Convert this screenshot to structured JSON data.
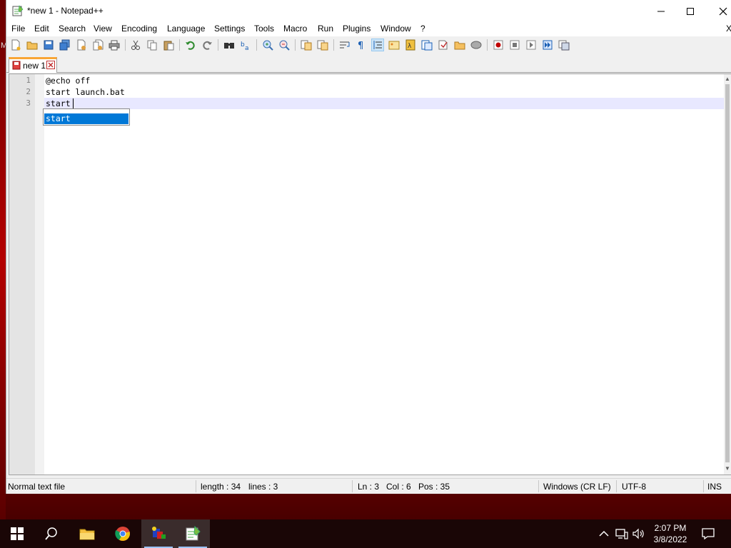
{
  "window": {
    "title": "*new 1 - Notepad++"
  },
  "desktop": {
    "edge_label": "M"
  },
  "menu": {
    "items": [
      "File",
      "Edit",
      "Search",
      "View",
      "Encoding",
      "Language",
      "Settings",
      "Tools",
      "Macro",
      "Run",
      "Plugins",
      "Window",
      "?"
    ],
    "close_label": "X"
  },
  "toolbar": {
    "icons": [
      "new-file-icon",
      "open-file-icon",
      "save-icon",
      "save-all-icon",
      "close-icon",
      "close-all-icon",
      "print-icon",
      "cut-icon",
      "copy-icon",
      "paste-icon",
      "undo-icon",
      "redo-icon",
      "find-icon",
      "replace-icon",
      "zoom-in-icon",
      "zoom-out-icon",
      "sync-v-icon",
      "sync-h-icon",
      "word-wrap-icon",
      "show-all-chars-icon",
      "indent-guide-icon",
      "udl-icon",
      "doc-map-icon",
      "function-list-icon",
      "folder-workspace-icon",
      "monitoring-icon",
      "record-macro-icon",
      "stop-macro-icon",
      "play-macro-icon",
      "run-macro-multiple-icon",
      "save-macro-icon"
    ]
  },
  "tabs": [
    {
      "label": "new 1",
      "modified": true
    }
  ],
  "editor": {
    "lines": [
      {
        "number": "1",
        "text": "@echo off"
      },
      {
        "number": "2",
        "text": "start launch.bat"
      },
      {
        "number": "3",
        "text": "start"
      }
    ],
    "autocomplete": {
      "items": [
        "start"
      ],
      "selected_index": 0
    }
  },
  "status": {
    "file_type": "Normal text file",
    "length": "length : 34",
    "lines": "lines : 3",
    "ln": "Ln : 3",
    "col": "Col : 6",
    "pos": "Pos : 35",
    "eol": "Windows (CR LF)",
    "encoding": "UTF-8",
    "mode": "INS"
  },
  "taskbar": {
    "apps": [
      "start-icon",
      "search-icon",
      "file-explorer-icon",
      "chrome-icon",
      "app-icon",
      "notepadpp-icon"
    ],
    "clock_time": "2:07 PM",
    "clock_date": "3/8/2022"
  },
  "colors": {
    "accent_tab": "#f9a535",
    "selection": "#0078d7",
    "current_line": "#e8e8ff",
    "desktop_red": "#c00000"
  }
}
